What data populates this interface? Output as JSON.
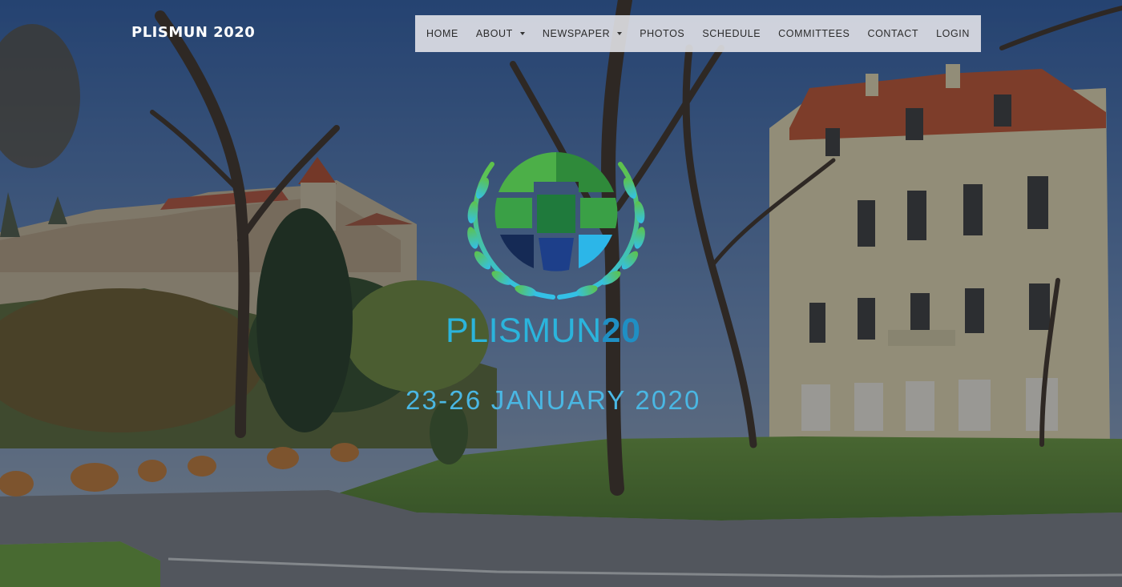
{
  "header": {
    "brand": "PLISMUN 2020"
  },
  "nav": {
    "items": [
      {
        "label": "HOME",
        "dropdown": false
      },
      {
        "label": "ABOUT",
        "dropdown": true
      },
      {
        "label": "NEWSPAPER",
        "dropdown": true
      },
      {
        "label": "PHOTOS",
        "dropdown": false
      },
      {
        "label": "SCHEDULE",
        "dropdown": false
      },
      {
        "label": "COMMITTEES",
        "dropdown": false
      },
      {
        "label": "CONTACT",
        "dropdown": false
      },
      {
        "label": "LOGIN",
        "dropdown": false
      }
    ]
  },
  "hero": {
    "wordmark_part1": "PLISMUN",
    "wordmark_part2": "20",
    "dates": "23-26 JANUARY 2020"
  },
  "colors": {
    "nav_bg": "#e6e6eb",
    "accent_blue": "#2bb4dc",
    "logo_green": "#2e9a3e",
    "logo_navy": "#1c2f66",
    "overlay": "#1a2026"
  }
}
